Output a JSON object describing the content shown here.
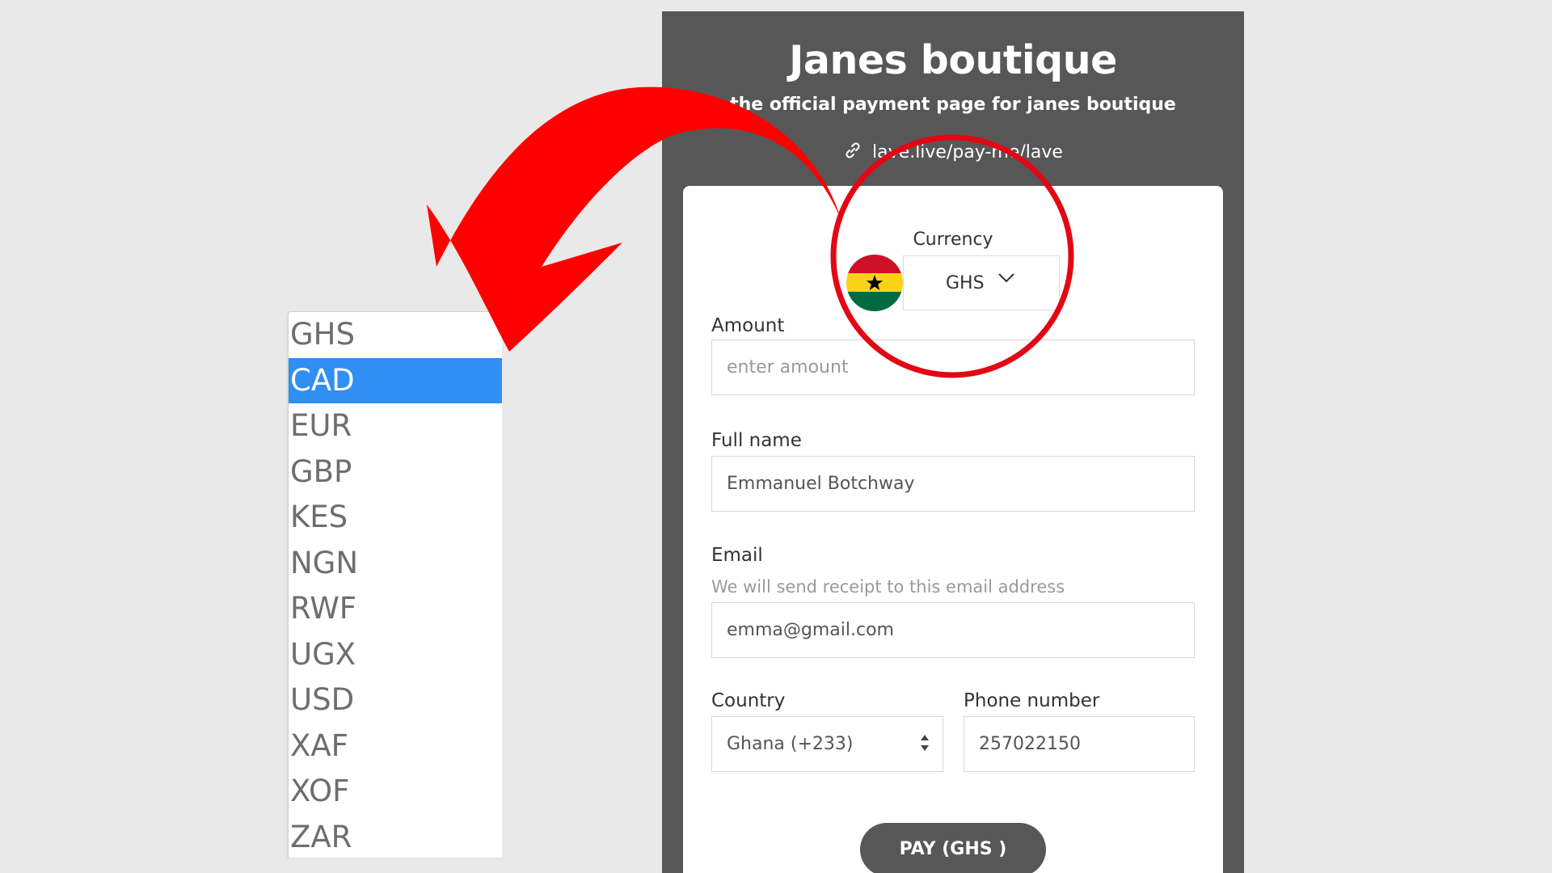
{
  "currency_dropdown": {
    "options": [
      {
        "label": "GHS",
        "selected": false
      },
      {
        "label": "CAD",
        "selected": true
      },
      {
        "label": "EUR",
        "selected": false
      },
      {
        "label": "GBP",
        "selected": false
      },
      {
        "label": "KES",
        "selected": false
      },
      {
        "label": "NGN",
        "selected": false
      },
      {
        "label": "RWF",
        "selected": false
      },
      {
        "label": "UGX",
        "selected": false
      },
      {
        "label": "USD",
        "selected": false
      },
      {
        "label": "XAF",
        "selected": false
      },
      {
        "label": "XOF",
        "selected": false
      },
      {
        "label": "ZAR",
        "selected": false
      }
    ],
    "highlight_color": "#2f8ff2"
  },
  "header": {
    "title": "Janes boutique",
    "subtitle": "the official payment page for janes boutique",
    "link_text": "lave.live/pay-me/lave",
    "link_icon": "link-icon",
    "background_color": "#575757"
  },
  "form": {
    "currency": {
      "label": "Currency",
      "value": "GHS",
      "flag": "ghana-flag-icon",
      "chevron": "chevron-down-icon"
    },
    "amount": {
      "label": "Amount",
      "placeholder": "enter amount",
      "value": ""
    },
    "full_name": {
      "label": "Full name",
      "value": "Emmanuel Botchway"
    },
    "email": {
      "label": "Email",
      "hint": "We will send receipt to this email address",
      "value": "emma@gmail.com"
    },
    "country": {
      "label": "Country",
      "value": "Ghana (+233)",
      "arrows": "select-arrows-icon"
    },
    "phone": {
      "label": "Phone number",
      "value": "257022150"
    },
    "pay_button_label": "PAY (GHS )"
  },
  "annotation": {
    "arrow_color": "#ff0000",
    "circle_color": "#e30613"
  }
}
